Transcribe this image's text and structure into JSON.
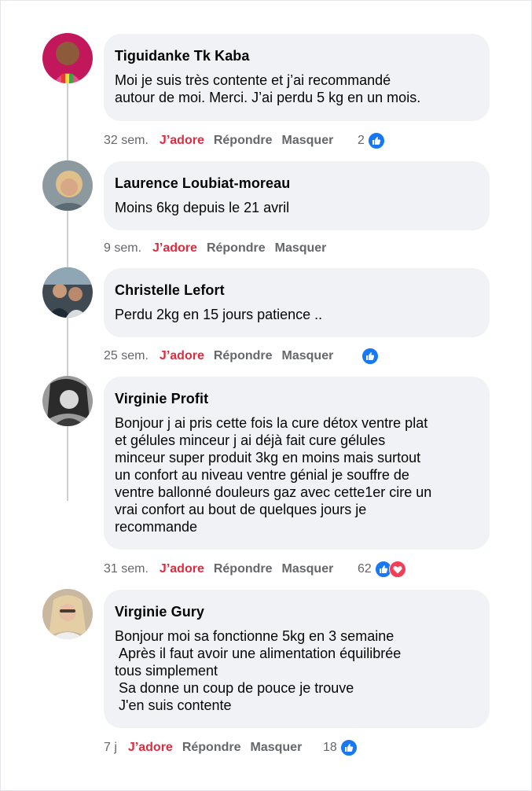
{
  "colors": {
    "bubble": "#f0f2f5",
    "like_active": "#e02b3e",
    "meta_text": "#65676b",
    "like_blue": "#1877f2",
    "love_red": "#f33e58"
  },
  "comments": [
    {
      "author": "Tiguidanke Tk Kaba",
      "text": "Moi je suis très contente et j’ai recommandé\nautour de moi. Merci. J’ai perdu 5 kg en un mois.",
      "time": "32 sem.",
      "like_label": "J’adore",
      "reply_label": "Répondre",
      "hide_label": "Masquer",
      "reaction_count": "2",
      "reactions": [
        "like-icon"
      ]
    },
    {
      "author": "Laurence Loubiat-moreau",
      "text": "Moins 6kg depuis le 21 avril",
      "time": "9 sem.",
      "like_label": "J’adore",
      "reply_label": "Répondre",
      "hide_label": "Masquer",
      "reaction_count": "",
      "reactions": []
    },
    {
      "author": "Christelle Lefort",
      "text": "Perdu 2kg en 15 jours patience ..",
      "time": "25 sem.",
      "like_label": "J’adore",
      "reply_label": "Répondre",
      "hide_label": "Masquer",
      "reaction_count": "",
      "reactions": [
        "like-icon"
      ]
    },
    {
      "author": "Virginie Profit",
      "text": "Bonjour j ai pris cette fois la cure détox ventre plat\net gélules minceur j ai déjà fait cure gélules\nminceur super produit 3kg en moins mais surtout\nun confort au niveau ventre génial je souffre de\nventre ballonné douleurs gaz avec cette1er cire un\nvrai confort au bout de quelques jours je\nrecommande",
      "time": "31 sem.",
      "like_label": "J’adore",
      "reply_label": "Répondre",
      "hide_label": "Masquer",
      "reaction_count": "62",
      "reactions": [
        "like-icon",
        "love-icon"
      ]
    },
    {
      "author": "Virginie Gury",
      "text": "Bonjour moi sa fonctionne 5kg en 3 semaine\n Après il faut avoir une alimentation équilibrée\ntous simplement\n Sa donne un coup de pouce je trouve\n J'en suis contente",
      "time": "7 j",
      "like_label": "J’adore",
      "reply_label": "Répondre",
      "hide_label": "Masquer",
      "reaction_count": "18",
      "reactions": [
        "like-icon"
      ]
    }
  ]
}
